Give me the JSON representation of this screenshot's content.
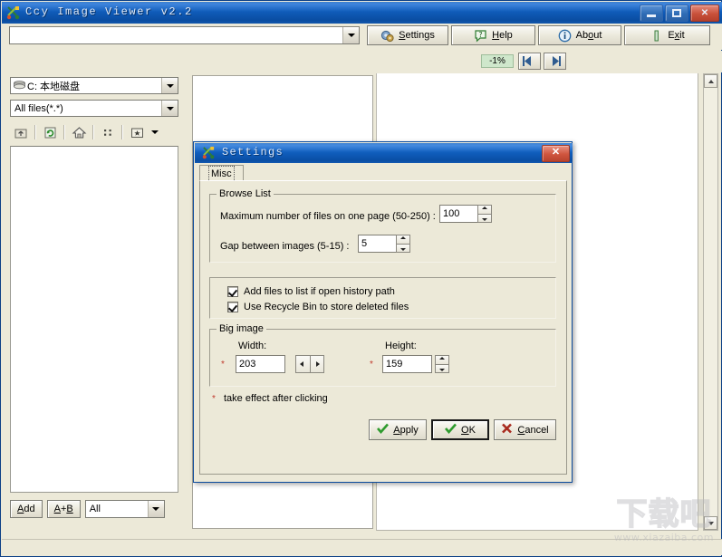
{
  "app": {
    "title": "Ccy Image Viewer v2.2",
    "icon": "app-scissors-icon",
    "window_buttons": {
      "minimize": "minimize-icon",
      "maximize": "maximize-icon",
      "close": "✕"
    }
  },
  "address_bar": {
    "value": "",
    "placeholder": "",
    "dropdown_icon": "chevron-down-icon"
  },
  "toolbar": {
    "buttons": [
      {
        "label_html": "<u>S</u>ettings",
        "label": "Settings",
        "icon": "settings-gear-icon"
      },
      {
        "label_html": "<u>H</u>elp",
        "label": "Help",
        "icon": "help-question-icon"
      },
      {
        "label_html": "Ab<u>o</u>ut",
        "label": "About",
        "icon": "about-info-icon"
      },
      {
        "label_html": "E<u>x</u>it",
        "label": "Exit",
        "icon": "exit-door-icon"
      }
    ]
  },
  "zoom_strip": {
    "zoom_label": "-1%",
    "prev_icon": "prev-image-icon",
    "next_icon": "next-image-icon"
  },
  "left_panel": {
    "drive_combo": {
      "value": "C: 本地磁盘",
      "icon": "drive-icon"
    },
    "filter_combo": {
      "value": "All files(*.*)"
    },
    "file_toolbar": [
      {
        "name": "up-folder-icon",
        "glyph": "↰"
      },
      {
        "name": "refresh-icon",
        "glyph": "↻"
      },
      {
        "name": "home-icon",
        "glyph": "⌂"
      },
      {
        "name": "list-view-icon",
        "glyph": "⠇"
      },
      {
        "name": "favorites-folder-icon",
        "glyph": "✷"
      },
      {
        "name": "favorites-dropdown-icon",
        "glyph": "▼"
      }
    ],
    "bottom_bar": {
      "add_label_html": "<u>A</u>dd",
      "add_label": "Add",
      "ab_label_html": "<u>A</u>+<u>B</u>",
      "ab_label": "A+B",
      "scope_combo": {
        "value": "All"
      }
    }
  },
  "settings_dialog": {
    "title": "Settings",
    "icon": "app-scissors-icon",
    "close_glyph": "✕",
    "tabs": [
      {
        "label": "Misc",
        "selected": true
      }
    ],
    "browse_list": {
      "group_title": "Browse List",
      "max_files_label": "Maximum number of files on one page (50-250) :",
      "max_files_value": "100",
      "gap_label": "Gap between images (5-15) :",
      "gap_value": "5"
    },
    "options": {
      "checkboxes": [
        {
          "label": "Add files to list if open history path",
          "checked": true
        },
        {
          "label": "Use Recycle Bin to store deleted files",
          "checked": true
        }
      ]
    },
    "big_image": {
      "group_title": "Big image",
      "width_label": "Width:",
      "width_value": "203",
      "height_label": "Height:",
      "height_value": "159",
      "required_marker": "*"
    },
    "footnote": {
      "marker": "*",
      "text": "take effect after clicking"
    },
    "buttons": [
      {
        "label_html": "<u>A</u>pply",
        "label": "Apply",
        "icon": "green-check-icon",
        "focused": false
      },
      {
        "label_html": "<u>O</u>K",
        "label": "OK",
        "icon": "green-check-icon",
        "focused": true
      },
      {
        "label_html": "<u>C</u>ancel",
        "label": "Cancel",
        "icon": "red-x-icon",
        "focused": false
      }
    ]
  },
  "watermark": {
    "big": "下载吧",
    "small": "www.xiazaiba.com"
  },
  "colors": {
    "titlebar_blue": "#0f5cba",
    "face": "#ece9d8",
    "zoom_badge_green": "#cfe7cb",
    "close_red": "#cf553e",
    "check_green": "#2e9b2e",
    "cancel_red": "#a82a1e"
  }
}
